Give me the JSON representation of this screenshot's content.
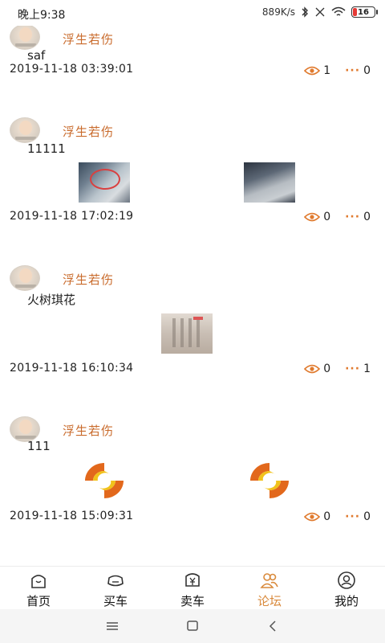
{
  "status_bar": {
    "time": "晚上9:38",
    "network_speed": "889K/s",
    "battery": "16"
  },
  "posts": [
    {
      "username": "浮生若伤",
      "content": "saf",
      "timestamp": "2019-11-18 03:39:01",
      "views": "1",
      "comments": "0",
      "images": []
    },
    {
      "username": "浮生若伤",
      "content": "11111",
      "timestamp": "2019-11-18 17:02:19",
      "views": "0",
      "comments": "0",
      "images": [
        "photo-screen",
        "photo-screen"
      ]
    },
    {
      "username": "浮生若伤",
      "content": "火树琪花",
      "timestamp": "2019-11-18 16:10:34",
      "views": "0",
      "comments": "1",
      "images": [
        "photo-document"
      ]
    },
    {
      "username": "浮生若伤",
      "content": "111",
      "timestamp": "2019-11-18 15:09:31",
      "views": "0",
      "comments": "0",
      "images": [
        "logo-image",
        "logo-image"
      ]
    }
  ],
  "tabbar": {
    "items": [
      {
        "label": "首页",
        "icon": "home-icon"
      },
      {
        "label": "买车",
        "icon": "car-icon"
      },
      {
        "label": "卖车",
        "icon": "yuan-icon"
      },
      {
        "label": "论坛",
        "icon": "forum-icon",
        "active": true
      },
      {
        "label": "我的",
        "icon": "profile-icon"
      }
    ]
  },
  "colors": {
    "accent": "#d98a3c",
    "username": "#c96b2c",
    "dots": "#e07a2e"
  }
}
